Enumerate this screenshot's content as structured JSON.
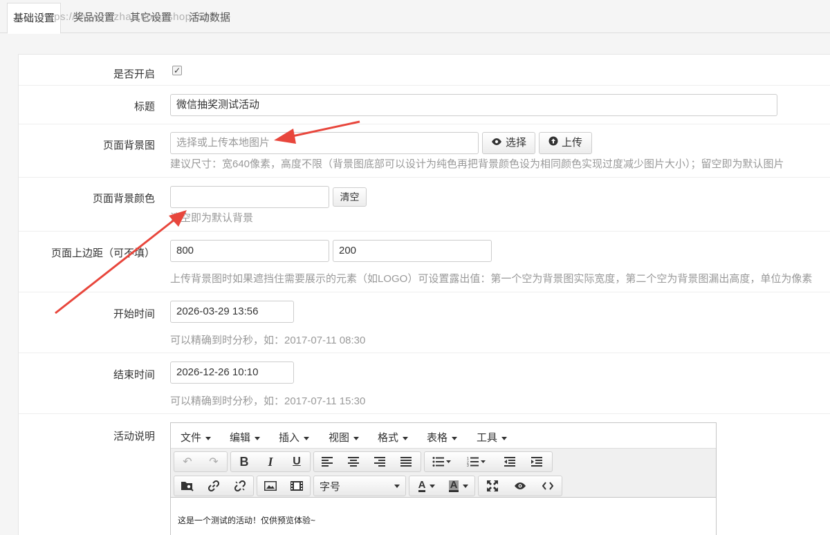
{
  "tabs": [
    "基础设置",
    "奖品设置",
    "其它设置",
    "活动数据"
  ],
  "watermark": "https://www.huzhan.com/ishop3592",
  "form": {
    "enable": {
      "label": "是否开启",
      "checked": true
    },
    "title": {
      "label": "标题",
      "value": "微信抽奖测试活动"
    },
    "bg_image": {
      "label": "页面背景图",
      "placeholder": "选择或上传本地图片",
      "select_label": "选择",
      "upload_label": "上传",
      "help": "建议尺寸：宽640像素，高度不限（背景图底部可以设计为纯色再把背景颜色设为相同颜色实现过度减少图片大小）；留空即为默认图片"
    },
    "bg_color": {
      "label": "页面背景颜色",
      "value": "",
      "clear_label": "清空",
      "help": "清空即为默认背景"
    },
    "top_margin": {
      "label": "页面上边距（可不填）",
      "value1": "800",
      "value2": "200",
      "help": "上传背景图时如果遮挡住需要展示的元素（如LOGO）可设置露出值：第一个空为背景图实际宽度，第二个空为背景图漏出高度，单位为像素"
    },
    "start_time": {
      "label": "开始时间",
      "value": "2026-03-29 13:56",
      "help": "可以精确到时分秒，如：2017-07-11 08:30"
    },
    "end_time": {
      "label": "结束时间",
      "value": "2026-12-26 10:10",
      "help": "可以精确到时分秒，如：2017-07-11 15:30"
    },
    "description": {
      "label": "活动说明",
      "content": "这是一个测试的活动！仅供预览体验~"
    }
  },
  "editor": {
    "menus": [
      "文件",
      "编辑",
      "插入",
      "视图",
      "格式",
      "表格",
      "工具"
    ],
    "font_size_label": "字号"
  },
  "colors": {
    "arrow": "#e8463c",
    "accent": "#333333"
  }
}
